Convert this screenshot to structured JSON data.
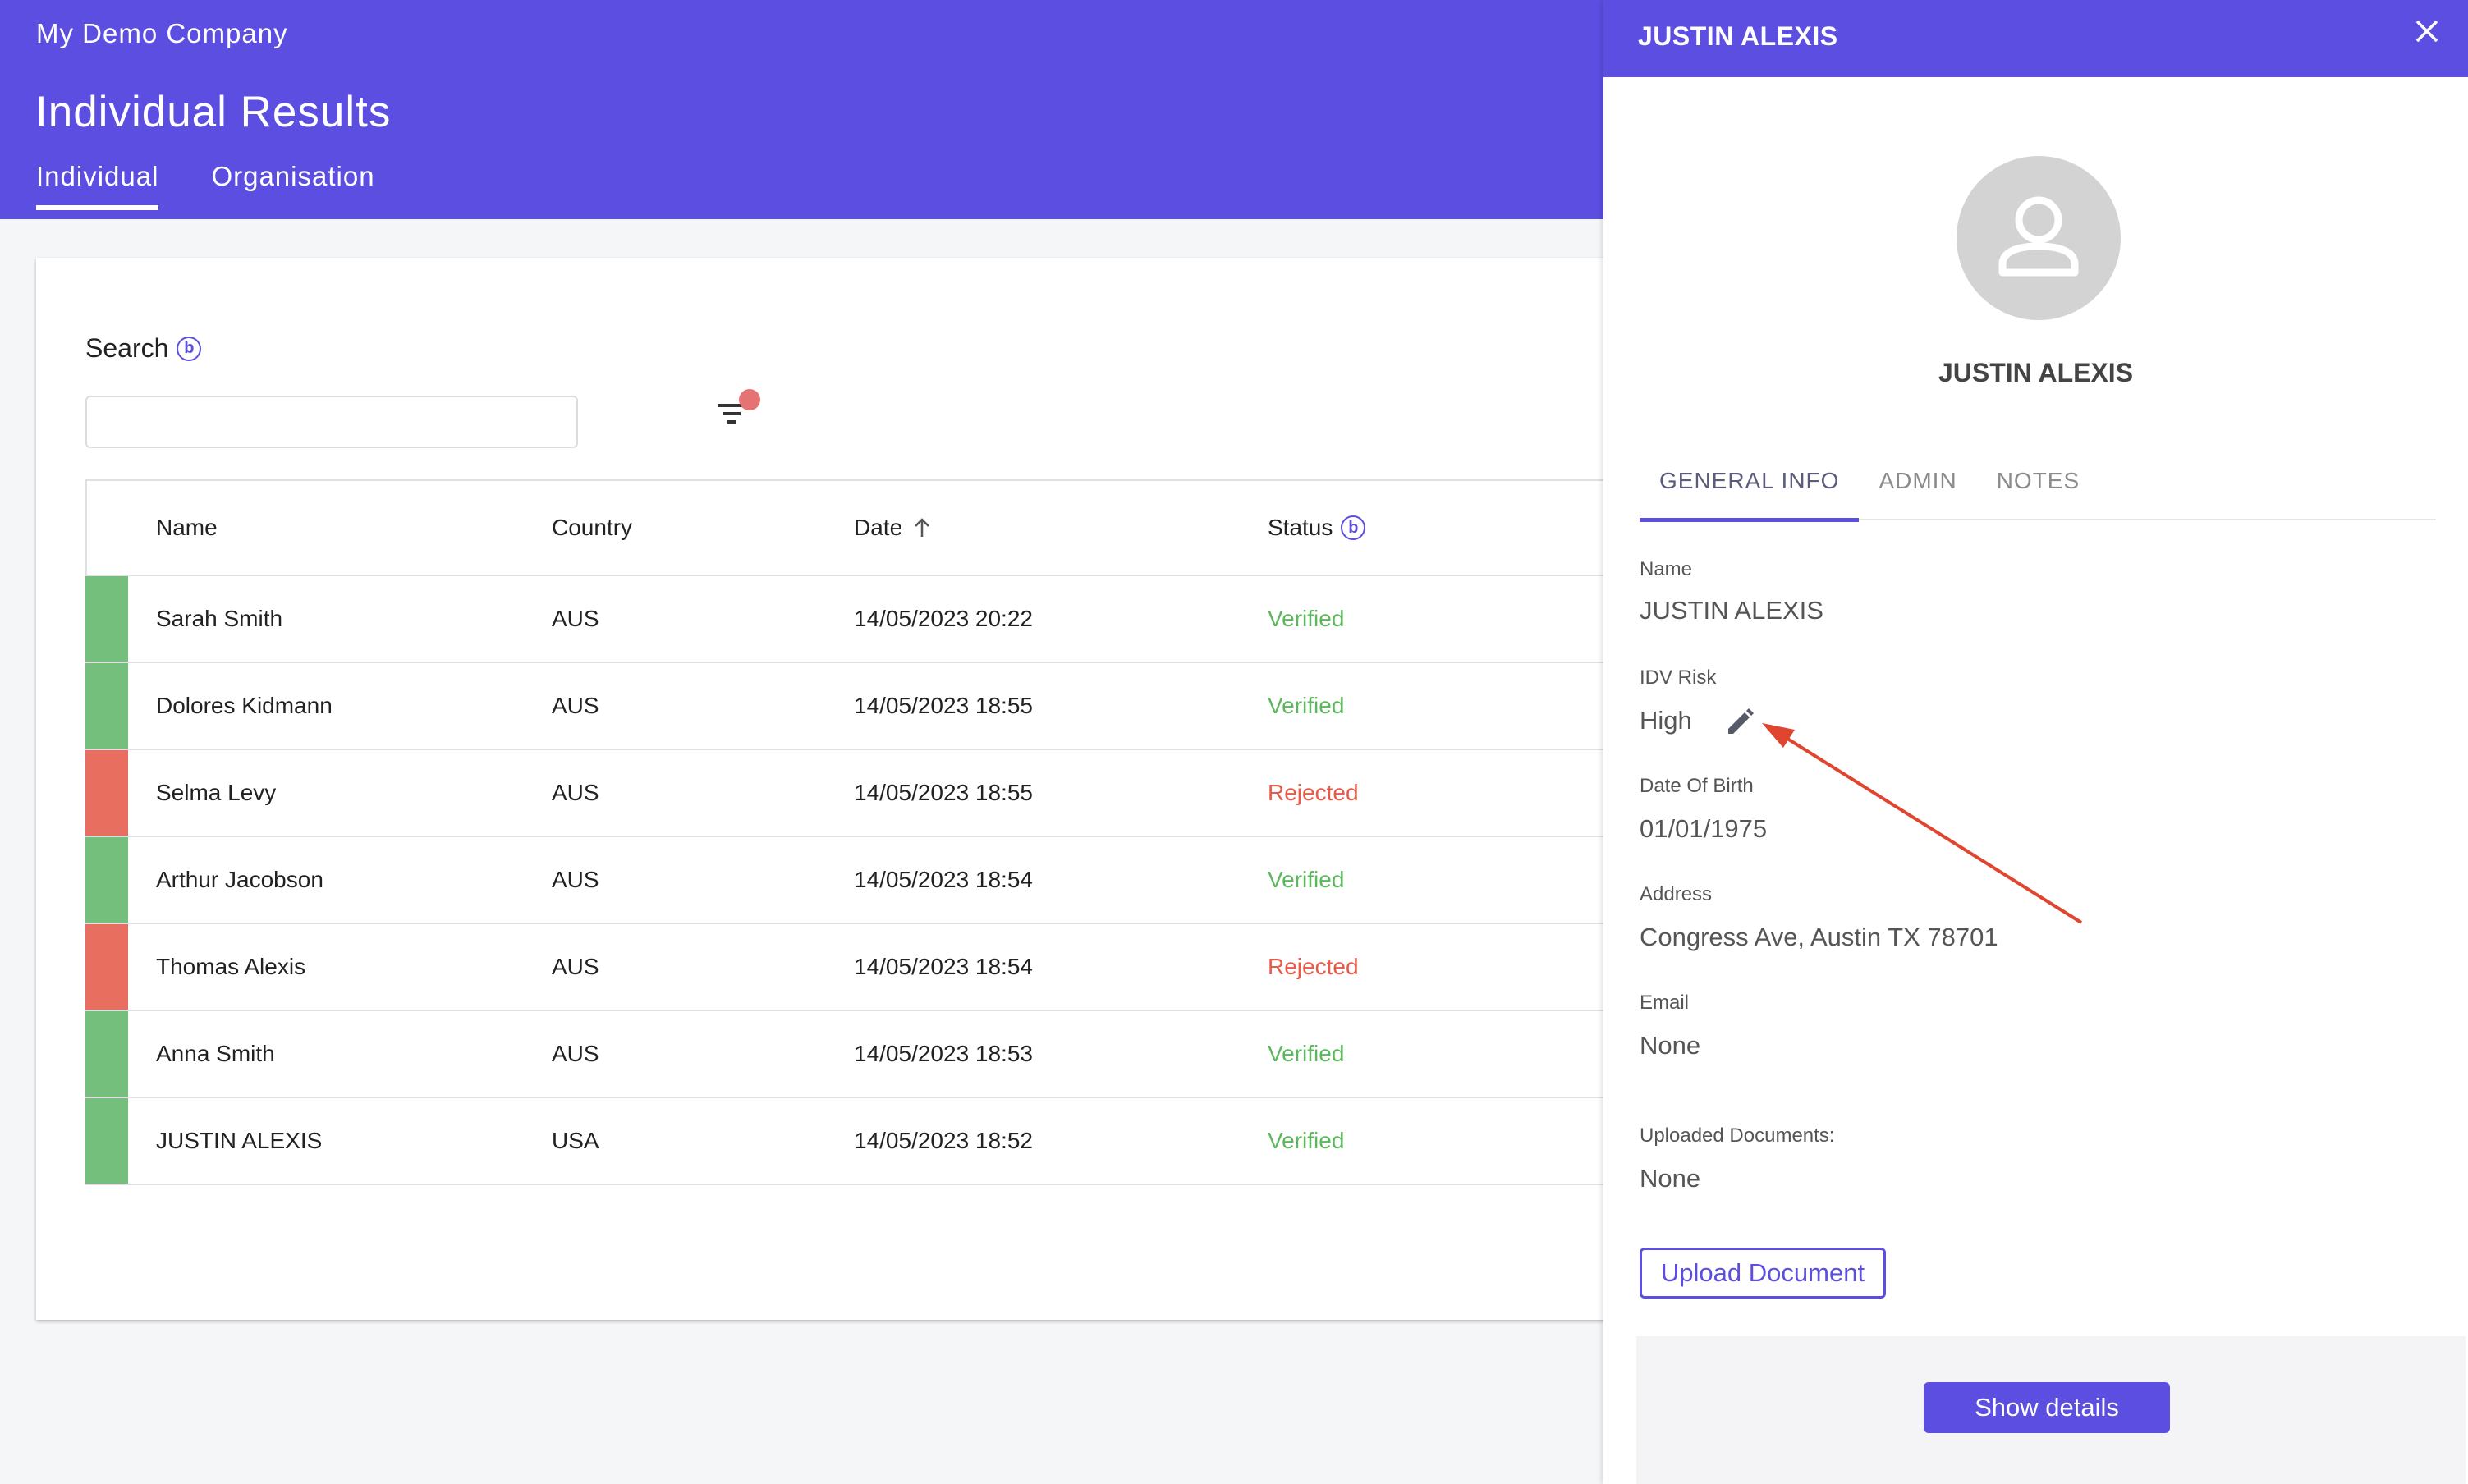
{
  "app": {
    "company": "My Demo Company",
    "title": "Individual Results"
  },
  "tabs": [
    {
      "label": "Individual"
    },
    {
      "label": "Organisation"
    }
  ],
  "search": {
    "label": "Search",
    "placeholder": ""
  },
  "table": {
    "headers": {
      "name": "Name",
      "country": "Country",
      "date": "Date",
      "status": "Status"
    },
    "rows": [
      {
        "name": "Sarah Smith",
        "country": "AUS",
        "date": "14/05/2023 20:22",
        "status": "Verified"
      },
      {
        "name": "Dolores Kidmann",
        "country": "AUS",
        "date": "14/05/2023 18:55",
        "status": "Verified"
      },
      {
        "name": "Selma Levy",
        "country": "AUS",
        "date": "14/05/2023 18:55",
        "status": "Rejected"
      },
      {
        "name": "Arthur Jacobson",
        "country": "AUS",
        "date": "14/05/2023 18:54",
        "status": "Verified"
      },
      {
        "name": "Thomas Alexis",
        "country": "AUS",
        "date": "14/05/2023 18:54",
        "status": "Rejected"
      },
      {
        "name": "Anna Smith",
        "country": "AUS",
        "date": "14/05/2023 18:53",
        "status": "Verified"
      },
      {
        "name": "JUSTIN ALEXIS",
        "country": "USA",
        "date": "14/05/2023 18:52",
        "status": "Verified"
      }
    ]
  },
  "panel": {
    "title": "JUSTIN ALEXIS",
    "name": "JUSTIN ALEXIS",
    "tabs": [
      {
        "label": "GENERAL INFO"
      },
      {
        "label": "ADMIN"
      },
      {
        "label": "NOTES"
      }
    ],
    "fields": {
      "name": {
        "label": "Name",
        "value": "JUSTIN ALEXIS"
      },
      "idv_risk": {
        "label": "IDV Risk",
        "value": "High"
      },
      "dob": {
        "label": "Date Of Birth",
        "value": "01/01/1975"
      },
      "address": {
        "label": "Address",
        "value": "Congress Ave, Austin TX 78701"
      },
      "email": {
        "label": "Email",
        "value": "None"
      },
      "documents": {
        "label": "Uploaded Documents:",
        "value": "None"
      }
    },
    "upload_label": "Upload Document",
    "show_details_label": "Show details"
  },
  "colors": {
    "accent": "#5c4ee0",
    "verified": "#73bf7b",
    "rejected": "#e86f5f"
  }
}
